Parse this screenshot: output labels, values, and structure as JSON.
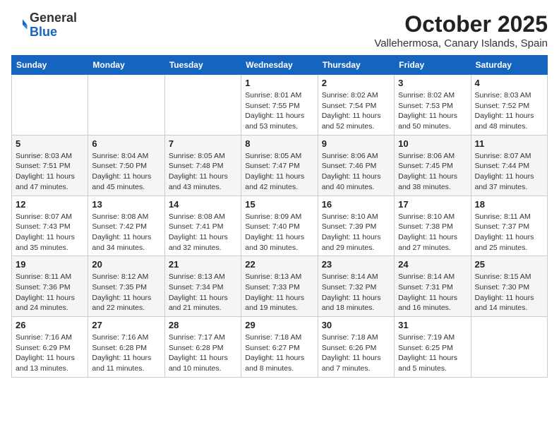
{
  "header": {
    "logo_general": "General",
    "logo_blue": "Blue",
    "month_title": "October 2025",
    "location": "Vallehermosa, Canary Islands, Spain"
  },
  "days_of_week": [
    "Sunday",
    "Monday",
    "Tuesday",
    "Wednesday",
    "Thursday",
    "Friday",
    "Saturday"
  ],
  "weeks": [
    [
      {
        "day": "",
        "info": ""
      },
      {
        "day": "",
        "info": ""
      },
      {
        "day": "",
        "info": ""
      },
      {
        "day": "1",
        "info": "Sunrise: 8:01 AM\nSunset: 7:55 PM\nDaylight: 11 hours\nand 53 minutes."
      },
      {
        "day": "2",
        "info": "Sunrise: 8:02 AM\nSunset: 7:54 PM\nDaylight: 11 hours\nand 52 minutes."
      },
      {
        "day": "3",
        "info": "Sunrise: 8:02 AM\nSunset: 7:53 PM\nDaylight: 11 hours\nand 50 minutes."
      },
      {
        "day": "4",
        "info": "Sunrise: 8:03 AM\nSunset: 7:52 PM\nDaylight: 11 hours\nand 48 minutes."
      }
    ],
    [
      {
        "day": "5",
        "info": "Sunrise: 8:03 AM\nSunset: 7:51 PM\nDaylight: 11 hours\nand 47 minutes."
      },
      {
        "day": "6",
        "info": "Sunrise: 8:04 AM\nSunset: 7:50 PM\nDaylight: 11 hours\nand 45 minutes."
      },
      {
        "day": "7",
        "info": "Sunrise: 8:05 AM\nSunset: 7:48 PM\nDaylight: 11 hours\nand 43 minutes."
      },
      {
        "day": "8",
        "info": "Sunrise: 8:05 AM\nSunset: 7:47 PM\nDaylight: 11 hours\nand 42 minutes."
      },
      {
        "day": "9",
        "info": "Sunrise: 8:06 AM\nSunset: 7:46 PM\nDaylight: 11 hours\nand 40 minutes."
      },
      {
        "day": "10",
        "info": "Sunrise: 8:06 AM\nSunset: 7:45 PM\nDaylight: 11 hours\nand 38 minutes."
      },
      {
        "day": "11",
        "info": "Sunrise: 8:07 AM\nSunset: 7:44 PM\nDaylight: 11 hours\nand 37 minutes."
      }
    ],
    [
      {
        "day": "12",
        "info": "Sunrise: 8:07 AM\nSunset: 7:43 PM\nDaylight: 11 hours\nand 35 minutes."
      },
      {
        "day": "13",
        "info": "Sunrise: 8:08 AM\nSunset: 7:42 PM\nDaylight: 11 hours\nand 34 minutes."
      },
      {
        "day": "14",
        "info": "Sunrise: 8:08 AM\nSunset: 7:41 PM\nDaylight: 11 hours\nand 32 minutes."
      },
      {
        "day": "15",
        "info": "Sunrise: 8:09 AM\nSunset: 7:40 PM\nDaylight: 11 hours\nand 30 minutes."
      },
      {
        "day": "16",
        "info": "Sunrise: 8:10 AM\nSunset: 7:39 PM\nDaylight: 11 hours\nand 29 minutes."
      },
      {
        "day": "17",
        "info": "Sunrise: 8:10 AM\nSunset: 7:38 PM\nDaylight: 11 hours\nand 27 minutes."
      },
      {
        "day": "18",
        "info": "Sunrise: 8:11 AM\nSunset: 7:37 PM\nDaylight: 11 hours\nand 25 minutes."
      }
    ],
    [
      {
        "day": "19",
        "info": "Sunrise: 8:11 AM\nSunset: 7:36 PM\nDaylight: 11 hours\nand 24 minutes."
      },
      {
        "day": "20",
        "info": "Sunrise: 8:12 AM\nSunset: 7:35 PM\nDaylight: 11 hours\nand 22 minutes."
      },
      {
        "day": "21",
        "info": "Sunrise: 8:13 AM\nSunset: 7:34 PM\nDaylight: 11 hours\nand 21 minutes."
      },
      {
        "day": "22",
        "info": "Sunrise: 8:13 AM\nSunset: 7:33 PM\nDaylight: 11 hours\nand 19 minutes."
      },
      {
        "day": "23",
        "info": "Sunrise: 8:14 AM\nSunset: 7:32 PM\nDaylight: 11 hours\nand 18 minutes."
      },
      {
        "day": "24",
        "info": "Sunrise: 8:14 AM\nSunset: 7:31 PM\nDaylight: 11 hours\nand 16 minutes."
      },
      {
        "day": "25",
        "info": "Sunrise: 8:15 AM\nSunset: 7:30 PM\nDaylight: 11 hours\nand 14 minutes."
      }
    ],
    [
      {
        "day": "26",
        "info": "Sunrise: 7:16 AM\nSunset: 6:29 PM\nDaylight: 11 hours\nand 13 minutes."
      },
      {
        "day": "27",
        "info": "Sunrise: 7:16 AM\nSunset: 6:28 PM\nDaylight: 11 hours\nand 11 minutes."
      },
      {
        "day": "28",
        "info": "Sunrise: 7:17 AM\nSunset: 6:28 PM\nDaylight: 11 hours\nand 10 minutes."
      },
      {
        "day": "29",
        "info": "Sunrise: 7:18 AM\nSunset: 6:27 PM\nDaylight: 11 hours\nand 8 minutes."
      },
      {
        "day": "30",
        "info": "Sunrise: 7:18 AM\nSunset: 6:26 PM\nDaylight: 11 hours\nand 7 minutes."
      },
      {
        "day": "31",
        "info": "Sunrise: 7:19 AM\nSunset: 6:25 PM\nDaylight: 11 hours\nand 5 minutes."
      },
      {
        "day": "",
        "info": ""
      }
    ]
  ]
}
